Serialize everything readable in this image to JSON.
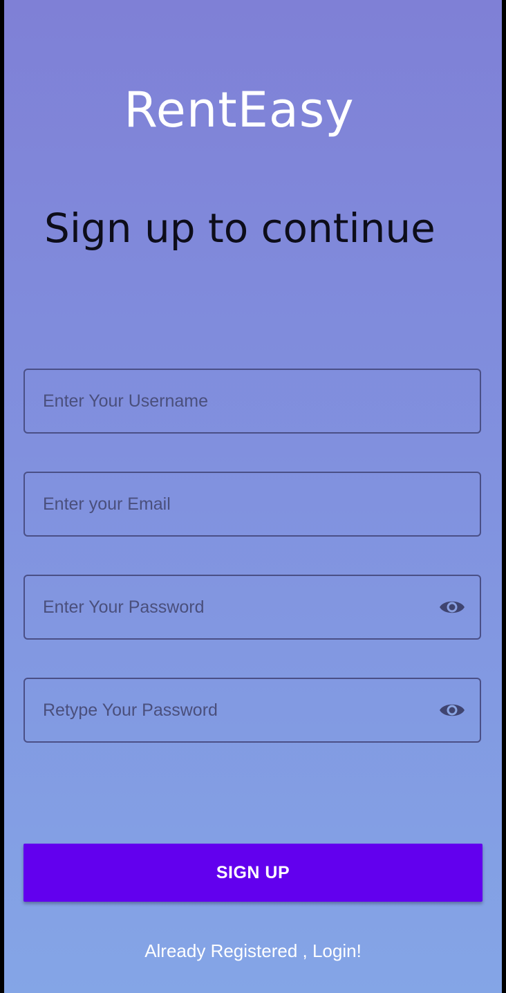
{
  "app": {
    "title": "RentEasy"
  },
  "headline": "Sign up to continue",
  "form": {
    "username": {
      "placeholder": "Enter Your Username",
      "value": ""
    },
    "email": {
      "placeholder": "Enter your Email",
      "value": ""
    },
    "password": {
      "placeholder": "Enter Your Password",
      "value": "",
      "toggle_icon": "eye-icon"
    },
    "retype_password": {
      "placeholder": "Retype Your Password",
      "value": "",
      "toggle_icon": "eye-icon"
    }
  },
  "buttons": {
    "signup_label": "SIGN UP"
  },
  "links": {
    "login_label": "Already Registered , Login!"
  },
  "colors": {
    "background_top": "#7f80d6",
    "background_bottom": "#84a5e6",
    "button": "#6200ee",
    "field_border": "#4a4f86"
  }
}
